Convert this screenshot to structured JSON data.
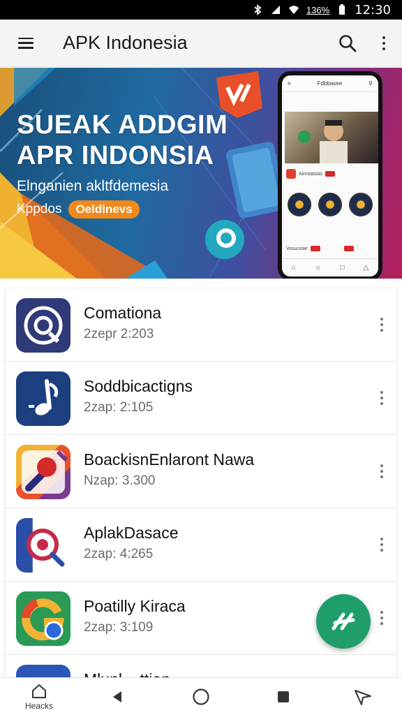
{
  "status_bar": {
    "battery_percent": "136%",
    "time": "12:30",
    "icons": [
      "bluetooth-icon",
      "signal-icon",
      "wifi-icon",
      "battery-icon"
    ]
  },
  "app_bar": {
    "title": "APK Indonesia",
    "icons": [
      "menu-icon",
      "search-icon",
      "more-vert-icon"
    ]
  },
  "banner": {
    "headline_line1": "SUEAK ADDGIM",
    "headline_line2": "APR INDONSIA",
    "subtitle": "Elnganien akltfdemesia",
    "subtitle2_prefix": "Kppdos",
    "subtitle2_pill": "Oeldinevs",
    "phone_mock": {
      "header": "Fdbbasee",
      "row1_text": "Ainntatsias",
      "row2_text": "Vosuceae"
    }
  },
  "apps": [
    {
      "name": "Comationa",
      "meta": "2zepr 2:203",
      "icon": "chat-ring-icon"
    },
    {
      "name": "Soddbicactigns",
      "meta": "2zap: 2:105",
      "icon": "music-note-icon"
    },
    {
      "name": "BoackisnEnlaront Nawa",
      "meta": "Nzap: 3.300",
      "icon": "ping-pong-paddle-icon"
    },
    {
      "name": "AplakDasace",
      "meta": "2zap: 4:265",
      "icon": "target-icon"
    },
    {
      "name": "Poatilly Kiraca",
      "meta": "2zap: 3:109",
      "icon": "google-like-icon"
    },
    {
      "name": "Mlunl ...ttion",
      "meta": "",
      "icon": "partial-app-icon"
    }
  ],
  "fab": {
    "icon": "apk-logo-icon"
  },
  "nav_bar": {
    "home_label": "Heacks",
    "icons": [
      "home-icon",
      "back-icon",
      "circle-home-icon",
      "square-recent-icon",
      "send-icon"
    ]
  },
  "colors": {
    "accent_green": "#1f9d6b",
    "app_bar_bg": "#f4f4f4",
    "banner_pill": "#f08a1c"
  }
}
